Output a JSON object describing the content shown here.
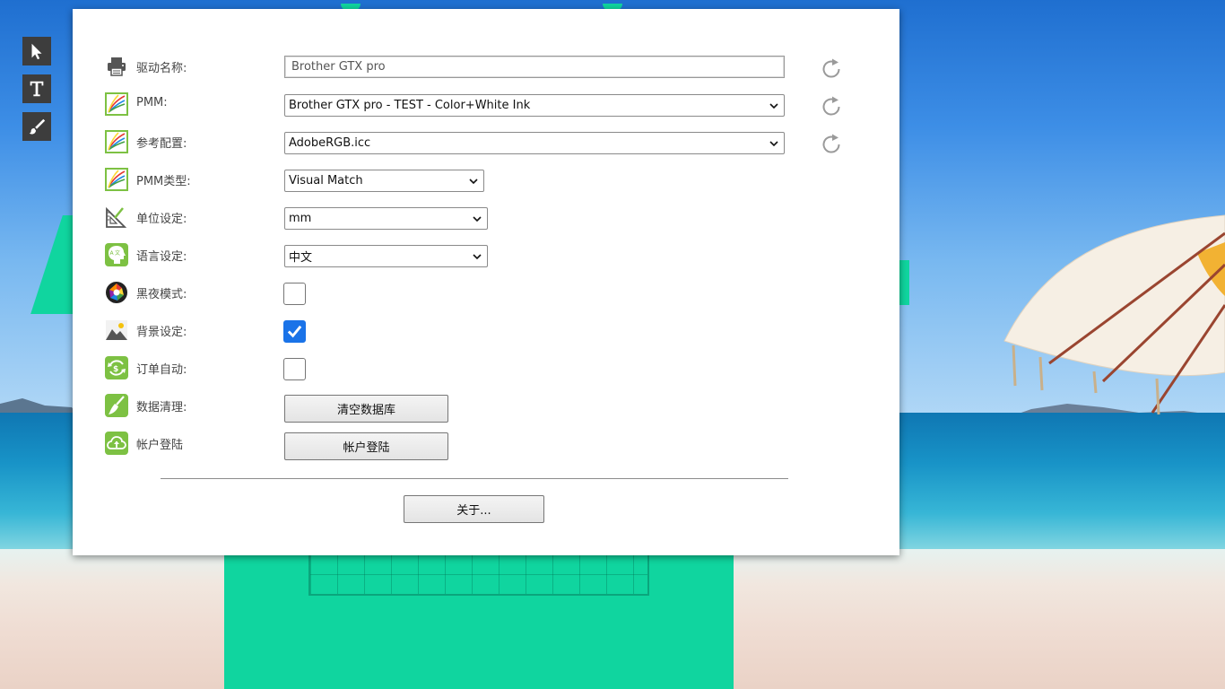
{
  "toolbar": {
    "tools": [
      {
        "name": "pointer-tool",
        "icon": "cursor-arrow-icon"
      },
      {
        "name": "text-tool",
        "icon": "text-t-icon"
      },
      {
        "name": "brush-tool",
        "icon": "brush-icon"
      }
    ]
  },
  "settings": {
    "driver": {
      "label": "驱动名称:",
      "icon": "printer-icon",
      "value": "Brother GTX pro"
    },
    "pmm": {
      "label": "PMM:",
      "icon": "color-profile-icon",
      "selected": "Brother GTX pro - TEST - Color+White Ink"
    },
    "reference_profile": {
      "label": "参考配置:",
      "icon": "color-profile-icon",
      "selected": "AdobeRGB.icc"
    },
    "pmm_type": {
      "label": "PMM类型:",
      "icon": "color-profile-icon",
      "selected": "Visual Match"
    },
    "units": {
      "label": "单位设定:",
      "icon": "ruler-triangle-icon",
      "selected": "mm"
    },
    "language": {
      "label": "语言设定:",
      "icon": "language-head-icon",
      "selected": "中文"
    },
    "dark_mode": {
      "label": "黑夜模式:",
      "icon": "aperture-icon",
      "checked": false
    },
    "background": {
      "label": "背景设定:",
      "icon": "landscape-icon",
      "checked": true
    },
    "auto_order": {
      "label": "订单自动:",
      "icon": "auto-cycle-icon",
      "checked": false
    },
    "data_cleanup": {
      "label": "数据清理:",
      "icon": "broom-icon",
      "button": "清空数据库"
    },
    "account": {
      "label": "帐户登陆",
      "icon": "cloud-upload-icon",
      "button": "帐户登陆"
    },
    "about_button": "关于..."
  },
  "colors": {
    "accent_green": "#7dc143",
    "checkbox_blue": "#1a73e8",
    "tool_bg": "#3d3d3d"
  }
}
